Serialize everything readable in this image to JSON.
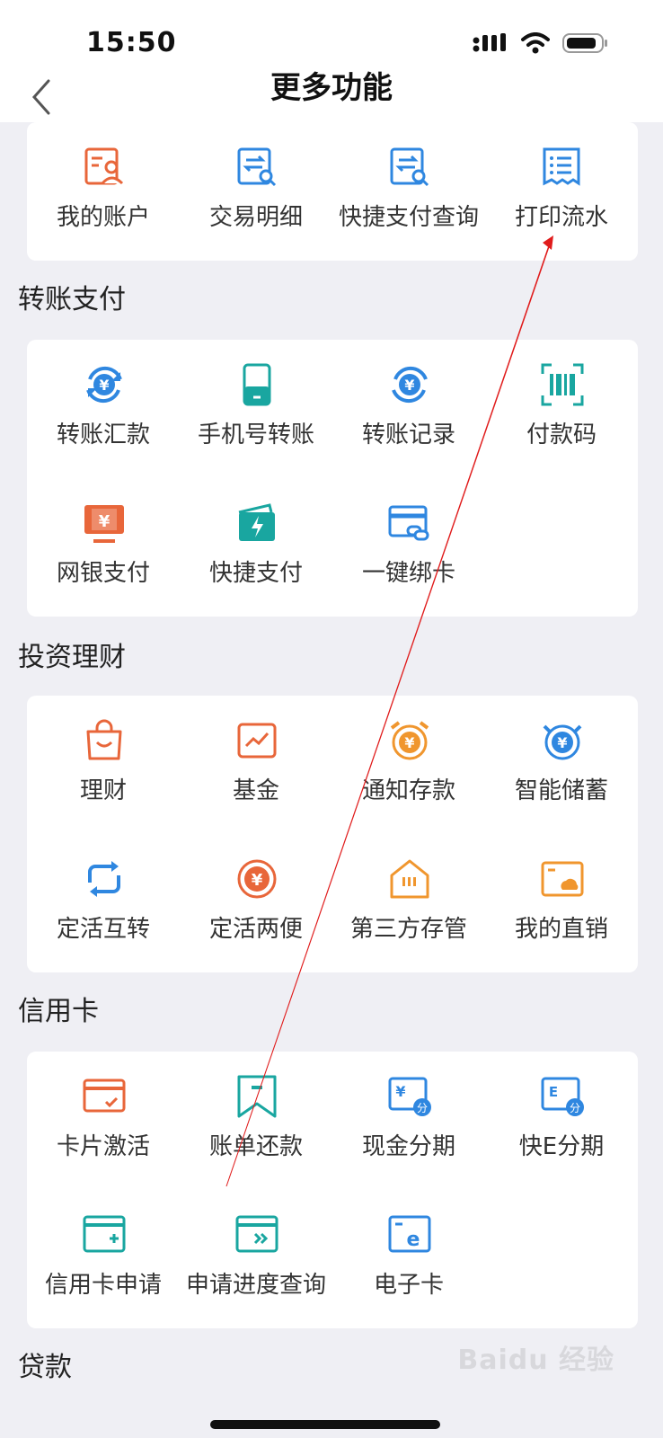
{
  "status": {
    "time": "15:50"
  },
  "header": {
    "title": "更多功能"
  },
  "sections": [
    {
      "title": "",
      "items": [
        {
          "label": "我的账户",
          "icon": "account-icon",
          "color": "#e8663a"
        },
        {
          "label": "交易明细",
          "icon": "transaction-detail-icon",
          "color": "#2f87e0"
        },
        {
          "label": "快捷支付查询",
          "icon": "quick-pay-query-icon",
          "color": "#2f87e0"
        },
        {
          "label": "打印流水",
          "icon": "print-statement-icon",
          "color": "#2f87e0"
        }
      ]
    },
    {
      "title": "转账支付",
      "items": [
        {
          "label": "转账汇款",
          "icon": "transfer-icon",
          "color": "#2f87e0"
        },
        {
          "label": "手机号转账",
          "icon": "phone-transfer-icon",
          "color": "#19a6a0"
        },
        {
          "label": "转账记录",
          "icon": "transfer-record-icon",
          "color": "#2f87e0"
        },
        {
          "label": "付款码",
          "icon": "payment-code-icon",
          "color": "#19a6a0"
        },
        {
          "label": "网银支付",
          "icon": "online-banking-pay-icon",
          "color": "#e8663a"
        },
        {
          "label": "快捷支付",
          "icon": "quick-pay-icon",
          "color": "#19a6a0"
        },
        {
          "label": "一键绑卡",
          "icon": "bind-card-icon",
          "color": "#2f87e0"
        }
      ]
    },
    {
      "title": "投资理财",
      "items": [
        {
          "label": "理财",
          "icon": "wealth-bag-icon",
          "color": "#e8663a"
        },
        {
          "label": "基金",
          "icon": "fund-chart-icon",
          "color": "#e8663a"
        },
        {
          "label": "通知存款",
          "icon": "notice-deposit-alarm-icon",
          "color": "#f0962e"
        },
        {
          "label": "智能储蓄",
          "icon": "smart-savings-icon",
          "color": "#2f87e0"
        },
        {
          "label": "定活互转",
          "icon": "exchange-icon",
          "color": "#2f87e0"
        },
        {
          "label": "定活两便",
          "icon": "yuan-circle-icon",
          "color": "#e8663a"
        },
        {
          "label": "第三方存管",
          "icon": "third-party-custody-icon",
          "color": "#f0962e"
        },
        {
          "label": "我的直销",
          "icon": "direct-sales-icon",
          "color": "#f0962e"
        }
      ]
    },
    {
      "title": "信用卡",
      "items": [
        {
          "label": "卡片激活",
          "icon": "card-activate-icon",
          "color": "#e8663a"
        },
        {
          "label": "账单还款",
          "icon": "bill-repay-icon",
          "color": "#19a6a0"
        },
        {
          "label": "现金分期",
          "icon": "cash-installment-icon",
          "color": "#2f87e0"
        },
        {
          "label": "快E分期",
          "icon": "e-installment-icon",
          "color": "#2f87e0"
        },
        {
          "label": "信用卡申请",
          "icon": "credit-card-apply-icon",
          "color": "#19a6a0"
        },
        {
          "label": "申请进度查询",
          "icon": "apply-progress-icon",
          "color": "#19a6a0"
        },
        {
          "label": "电子卡",
          "icon": "e-card-icon",
          "color": "#2f87e0"
        }
      ]
    },
    {
      "title": "贷款",
      "items": []
    }
  ],
  "watermark": "Baidu 经验"
}
